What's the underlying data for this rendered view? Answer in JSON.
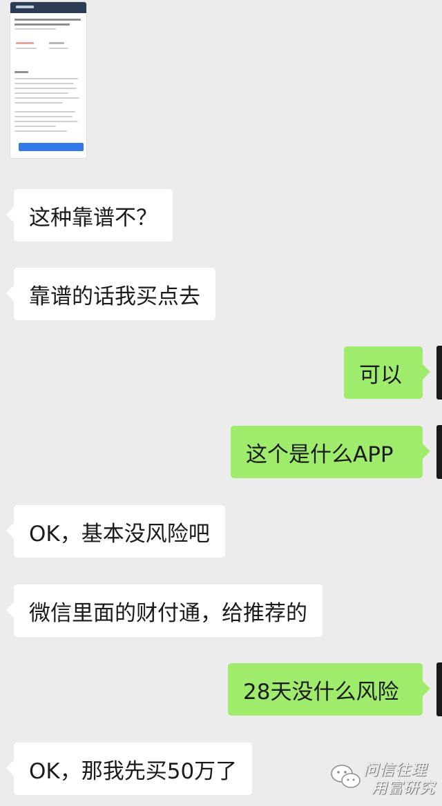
{
  "messages": [
    {
      "side": "in",
      "text": "这种靠谱不？"
    },
    {
      "side": "in",
      "text": "靠谱的话我买点去"
    },
    {
      "side": "out",
      "text": "可以"
    },
    {
      "side": "out",
      "text": "这个是什么APP"
    },
    {
      "side": "in",
      "text": "OK，基本没风险吧"
    },
    {
      "side": "in",
      "text": "微信里面的财付通，给推荐的"
    },
    {
      "side": "out",
      "text": "28天没什么风险"
    },
    {
      "side": "in",
      "text": "OK，那我先买50万了"
    }
  ],
  "watermark": {
    "line1": "问信往理",
    "line2": "用富研究"
  },
  "colors": {
    "background": "#ececec",
    "incoming_bubble": "#ffffff",
    "outgoing_bubble": "#9feb6b"
  },
  "icons": {
    "shared_image": "screenshot-thumbnail",
    "watermark_logo": "wechat-logo-icon"
  }
}
